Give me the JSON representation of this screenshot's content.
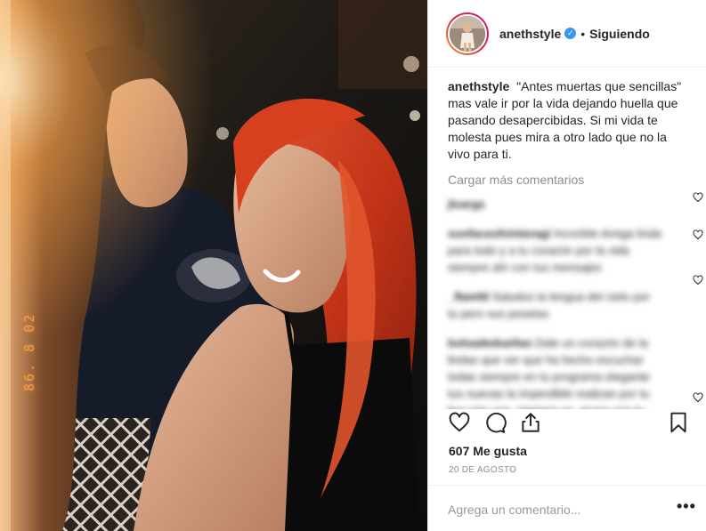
{
  "post": {
    "photo_date_stamp": "86. 8 02",
    "header": {
      "username": "anethstyle",
      "verified_icon": "verified-check-icon",
      "separator": "•",
      "follow_status": "Siguiendo"
    },
    "caption": {
      "username": "anethstyle",
      "text": "\"Antes muertas que sencillas\" mas vale ir por la vida dejando huella que pasando desapercibidas. Si mi vida te molesta pues mira a otro lado que no la vivo para ti."
    },
    "load_more_label": "Cargar más comentarios",
    "blurred_comments": [
      {
        "username": "jlvargs",
        "text": ""
      },
      {
        "username": "sunfaceofvinteragi",
        "text": "Increíble Amiga linda para todo y a tu corazón por la vida siempre ahí con tus mensajes"
      },
      {
        "username": "_flamfd",
        "text": "Saludos la lengua del cielo por tu pero sus pesetas"
      },
      {
        "username": "bolsadedueñas",
        "text": "Dale un corazón de la lindas que ver que ha hecho escuchar todas siempre en tu programa elegante tus nuevas la imperdible realizan por tu hoy mis una, siempre yo, grupo con tu pre"
      }
    ],
    "actions": {
      "like_icon": "heart-outline-icon",
      "comment_icon": "comment-bubble-icon",
      "share_icon": "share-upload-icon",
      "save_icon": "bookmark-icon"
    },
    "likes_label": "607 Me gusta",
    "date_label": "20 DE AGOSTO",
    "add_comment": {
      "placeholder": "Agrega un comentario...",
      "more_label": "•••",
      "more_icon": "more-options-icon"
    }
  },
  "colors": {
    "verified": "#3897f0",
    "text_primary": "#262626",
    "text_secondary": "#8e8e8e",
    "divider": "#efefef",
    "hair_red": "#c8321c"
  }
}
